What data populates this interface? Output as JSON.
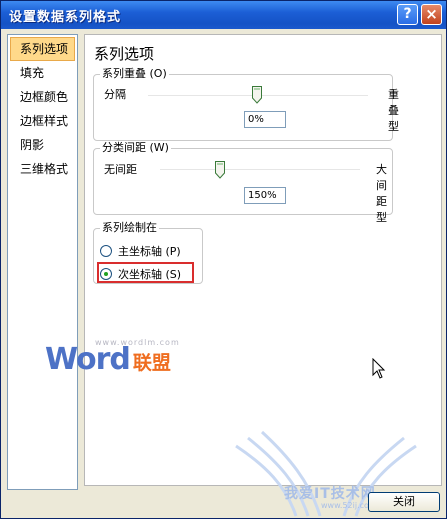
{
  "window": {
    "title": "设置数据系列格式",
    "help": "?",
    "close": "×"
  },
  "nav": {
    "items": [
      "系列选项",
      "填充",
      "边框颜色",
      "边框样式",
      "阴影",
      "三维格式"
    ]
  },
  "content": {
    "title": "系列选项",
    "overlap": {
      "legend": "系列重叠 (O)",
      "min_label": "分隔",
      "max_label": "重叠型",
      "value": "0%"
    },
    "gap": {
      "legend": "分类间距 (W)",
      "min_label": "无间距",
      "max_label": "大间距型",
      "value": "150%"
    },
    "plot_on": {
      "legend": "系列绘制在",
      "primary": "主坐标轴 (P)",
      "secondary": "次坐标轴 (S)"
    }
  },
  "footer": {
    "close_label": "关闭"
  },
  "watermark": {
    "url": "www.wordlm.com",
    "word": "Word",
    "cn": "联盟",
    "bottom_text": "我爱IT技术网",
    "bottom_url": "www.52ij.com"
  }
}
